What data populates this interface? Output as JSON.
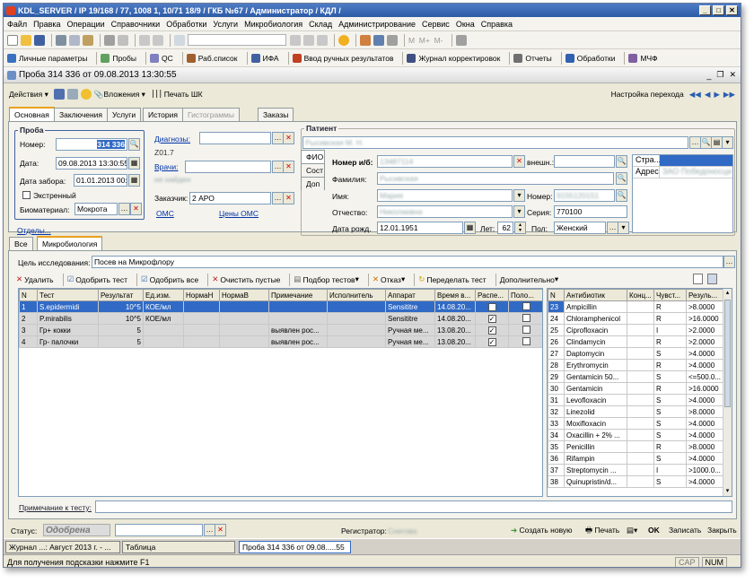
{
  "window": {
    "title": "KDL_SERVER / IP   19/168 / 77, 1008 1, 10/71 18/9 / ГКБ №67 / Администратор / КДЛ /"
  },
  "menu": [
    "Файл",
    "Правка",
    "Операции",
    "Справочники",
    "Обработки",
    "Услуги",
    "Микробиология",
    "Склад",
    "Администрирование",
    "Сервис",
    "Окна",
    "Справка"
  ],
  "toolbar2": [
    "Личные параметры",
    "Пробы",
    "QC",
    "Раб.список",
    "ИФА",
    "Ввод ручных результатов",
    "Журнал корректировок",
    "Отчеты",
    "Обработки",
    "МЧФ"
  ],
  "doc": {
    "title": "Проба 314 336 от 09.08.2013 13:30:55"
  },
  "doctoolbar": {
    "actions": "Действия",
    "attachments": "Вложения",
    "print_barcode": "Печать ШК",
    "goto": "Настройка перехода"
  },
  "tabs": [
    "Основная",
    "Заключения",
    "Услуги",
    "История",
    "Гистограммы",
    "Заказы"
  ],
  "sample": {
    "group": "Проба",
    "number_label": "Номер:",
    "number": "314 336",
    "date_label": "Дата:",
    "date": "09.08.2013 13:30:55",
    "taken_label": "Дата забора:",
    "taken": "01.01.2013 00:0",
    "urgent": "Экстренный",
    "biomaterial_label": "Биоматериал:",
    "biomaterial": "Мокрота"
  },
  "mid": {
    "diagnosis_link": "Диагнозы:",
    "diagnosis_code": "Z01.7",
    "doctor_link": "Врачи:",
    "doctor_sub": "не найден",
    "customer_label": "Заказчик:",
    "customer": "2 АРО",
    "oms": "ОМС",
    "oms_prices": "Цены ОМС"
  },
  "patient": {
    "group": "Патиент",
    "name": "Рысивская М. Н.",
    "tab_fio": "ФИО",
    "tab_sost": "Сост",
    "tab_dop": "Доп",
    "card_label": "Номер и/б:",
    "card": "13487114",
    "ext_label": "внешн.:",
    "surname_label": "Фамилия:",
    "surname": "Рысивская",
    "name_label": "Имя:",
    "first": "Мария",
    "number_label": "Номер:",
    "doc_number": "9155120151",
    "patr_label": "Отчество:",
    "patr": "Николаевна",
    "series_label": "Серия:",
    "series": "770100",
    "dob_label": "Дата рожд.",
    "dob": "12.01.1951",
    "age_label": "Лет:",
    "age": "62",
    "sex_label": "Пол:",
    "sex": "Женский",
    "side_country": "Стра...",
    "side_addr": "Адрес",
    "side_addr_val": "ЗАО Победоносци"
  },
  "departments": "Отделы...",
  "subtabs": [
    "Все",
    "Микробиология"
  ],
  "research": {
    "label": "Цель исследования:",
    "value": "Посев на Микрофлору"
  },
  "micro_toolbar": [
    "Удалить",
    "Одобрить тест",
    "Одобрить все",
    "Очистить пустые",
    "Подбор тестов",
    "Отказ",
    "Переделать тест",
    "Дополнительно"
  ],
  "tests": {
    "headers": [
      "N",
      "Тест",
      "Результат",
      "Ед.изм.",
      "НормаН",
      "НормаВ",
      "Примечание",
      "Исполнитель",
      "Аппарат",
      "Время в...",
      "Распе...",
      "Поло..."
    ],
    "rows": [
      [
        "1",
        "S.epidermidi",
        "10^5",
        "КОЕ/мл",
        "",
        "",
        "",
        "",
        "Sensititre",
        "14.08.20...",
        "✓",
        ""
      ],
      [
        "2",
        "P.mirabilis",
        "10^5",
        "КОЕ/мл",
        "",
        "",
        "",
        "",
        "Sensititre",
        "14.08.20...",
        "✓",
        ""
      ],
      [
        "3",
        "Гр+ кокки",
        "5",
        "",
        "",
        "",
        "выявлен рос...",
        "",
        "Ручная ме...",
        "13.08.20...",
        "✓",
        ""
      ],
      [
        "4",
        "Гр- палочки",
        "5",
        "",
        "",
        "",
        "выявлен рос...",
        "",
        "Ручная ме...",
        "13.08.20...",
        "✓",
        ""
      ]
    ]
  },
  "antibiotics": {
    "headers": [
      "N",
      "Антибиотик",
      "Конц...",
      "Чувст...",
      "Резуль..."
    ],
    "rows": [
      [
        "23",
        "Ampicillin",
        "",
        "R",
        ">8.0000"
      ],
      [
        "24",
        "Chloramphenicol",
        "",
        "R",
        ">16.0000"
      ],
      [
        "25",
        "Ciprofloxacin",
        "",
        "I",
        ">2.0000"
      ],
      [
        "26",
        "Clindamycin",
        "",
        "R",
        ">2.0000"
      ],
      [
        "27",
        "Daptomycin",
        "",
        "S",
        ">4.0000"
      ],
      [
        "28",
        "Erythromycin",
        "",
        "R",
        ">4.0000"
      ],
      [
        "29",
        "Gentamicin 50...",
        "",
        "S",
        "<=500.0..."
      ],
      [
        "30",
        "Gentamicin",
        "",
        "R",
        ">16.0000"
      ],
      [
        "31",
        "Levofloxacin",
        "",
        "S",
        ">4.0000"
      ],
      [
        "32",
        "Linezolid",
        "",
        "S",
        ">8.0000"
      ],
      [
        "33",
        "Moxifloxacin",
        "",
        "S",
        ">4.0000"
      ],
      [
        "34",
        "Oxacillin + 2% ...",
        "",
        "S",
        ">4.0000"
      ],
      [
        "35",
        "Penicillin",
        "",
        "R",
        ">8.0000"
      ],
      [
        "36",
        "Rifampin",
        "",
        "S",
        ">4.0000"
      ],
      [
        "37",
        "Streptomycin ...",
        "",
        "I",
        ">1000.0..."
      ],
      [
        "38",
        "Quinupristin/d...",
        "",
        "S",
        ">4.0000"
      ]
    ]
  },
  "note_label": "Примечание к тесту:",
  "bottom": {
    "status_label": "Статус:",
    "status": "Одобрена",
    "registrar_label": "Регистратор:",
    "registrar": "Снегова",
    "create": "Создать новую",
    "print": "Печать",
    "ok": "OK",
    "save": "Записать",
    "close": "Закрыть"
  },
  "taskbar": [
    "Журнал ...: Август 2013 г. - ...",
    "Таблица",
    "Проба 314 336 от 09.08.....55"
  ],
  "statusbar": {
    "hint": "Для получения подсказки нажмите F1",
    "cap": "CAP",
    "num": "NUM"
  },
  "colors": {
    "title": "#2c5ba8",
    "selected": "#316ac5",
    "status": "#7a7a7a"
  }
}
